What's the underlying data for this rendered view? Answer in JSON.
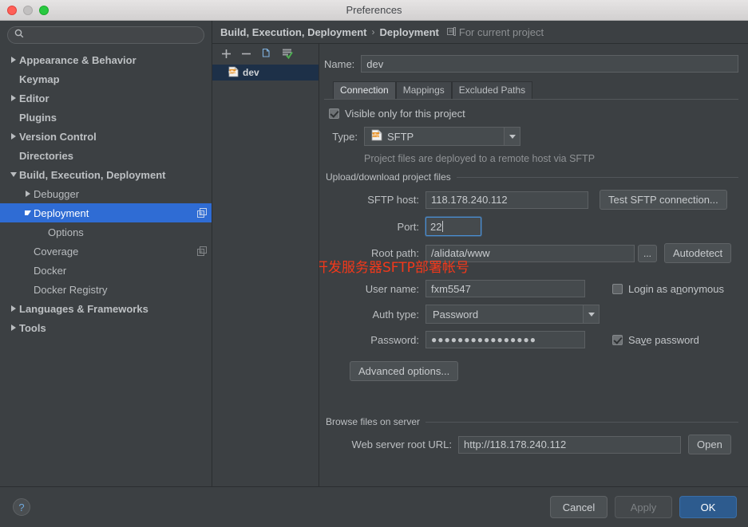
{
  "window": {
    "title": "Preferences"
  },
  "search": {
    "value": "",
    "placeholder": "",
    "icon": "search-icon"
  },
  "sidebar": {
    "items": [
      {
        "label": "Appearance & Behavior",
        "arrow": "right",
        "indent": 0,
        "bold": true,
        "selected": false,
        "badge": false
      },
      {
        "label": "Keymap",
        "arrow": "none",
        "indent": 0,
        "bold": true,
        "selected": false,
        "badge": false
      },
      {
        "label": "Editor",
        "arrow": "right",
        "indent": 0,
        "bold": true,
        "selected": false,
        "badge": false
      },
      {
        "label": "Plugins",
        "arrow": "none",
        "indent": 0,
        "bold": true,
        "selected": false,
        "badge": false
      },
      {
        "label": "Version Control",
        "arrow": "right",
        "indent": 0,
        "bold": true,
        "selected": false,
        "badge": false
      },
      {
        "label": "Directories",
        "arrow": "none",
        "indent": 0,
        "bold": true,
        "selected": false,
        "badge": false
      },
      {
        "label": "Build, Execution, Deployment",
        "arrow": "down",
        "indent": 0,
        "bold": true,
        "selected": false,
        "badge": false
      },
      {
        "label": "Debugger",
        "arrow": "right",
        "indent": 1,
        "bold": false,
        "selected": false,
        "badge": false
      },
      {
        "label": "Deployment",
        "arrow": "down",
        "indent": 1,
        "bold": false,
        "selected": true,
        "badge": true
      },
      {
        "label": "Options",
        "arrow": "none",
        "indent": 2,
        "bold": false,
        "selected": false,
        "badge": false
      },
      {
        "label": "Coverage",
        "arrow": "none",
        "indent": 1,
        "bold": false,
        "selected": false,
        "badge": true
      },
      {
        "label": "Docker",
        "arrow": "none",
        "indent": 1,
        "bold": false,
        "selected": false,
        "badge": false
      },
      {
        "label": "Docker Registry",
        "arrow": "none",
        "indent": 1,
        "bold": false,
        "selected": false,
        "badge": false
      },
      {
        "label": "Languages & Frameworks",
        "arrow": "right",
        "indent": 0,
        "bold": true,
        "selected": false,
        "badge": false
      },
      {
        "label": "Tools",
        "arrow": "right",
        "indent": 0,
        "bold": true,
        "selected": false,
        "badge": false
      }
    ]
  },
  "breadcrumb": {
    "root": "Build, Execution, Deployment",
    "separator": "›",
    "leaf": "Deployment",
    "scope_note": "For current project",
    "scope_icon": "project-scope-icon"
  },
  "server_list": {
    "toolbar": [
      {
        "name": "add-server-button",
        "glyph": "+"
      },
      {
        "name": "remove-server-button",
        "glyph": "−"
      },
      {
        "name": "copy-server-button",
        "glyph": "copy-icon"
      },
      {
        "name": "set-default-server-button",
        "glyph": "server-check-icon"
      }
    ],
    "items": [
      {
        "label": "dev",
        "icon": "sftp-icon",
        "selected": true
      }
    ]
  },
  "form": {
    "name_label": "Name:",
    "name_value": "dev",
    "tabs": [
      {
        "label": "Connection",
        "active": true
      },
      {
        "label": "Mappings",
        "active": false
      },
      {
        "label": "Excluded Paths",
        "active": false
      }
    ],
    "visible_only": {
      "label": "Visible only for this project",
      "checked": true
    },
    "type": {
      "label": "Type:",
      "value": "SFTP",
      "icon": "sftp-icon"
    },
    "type_hint": "Project files are deployed to a remote host via SFTP",
    "upload_group": "Upload/download project files",
    "sftp_host": {
      "label": "SFTP host:",
      "value": "118.178.240.112"
    },
    "test_button": "Test SFTP connection...",
    "port": {
      "label": "Port:",
      "value": "22",
      "focused": true
    },
    "root_path": {
      "label": "Root path:",
      "value": "/alidata/www"
    },
    "browse_button": "...",
    "autodetect_button": "Autodetect",
    "user_name": {
      "label": "User name:",
      "value": "fxm5547"
    },
    "login_anonymous": {
      "label_pre": "Login as a",
      "label_mnemonic": "n",
      "label_post": "onymous",
      "checked": false
    },
    "auth_type": {
      "label": "Auth type:",
      "value": "Password"
    },
    "password": {
      "label": "Password:",
      "value": "●●●●●●●●●●●●●●●●"
    },
    "save_password": {
      "label_pre": "Sa",
      "label_mnemonic": "v",
      "label_post": "e password",
      "checked": true
    },
    "advanced_button": "Advanced options...",
    "browse_group": "Browse files on server",
    "web_url": {
      "label": "Web server root URL:",
      "value": "http://118.178.240.112"
    },
    "open_button": "Open"
  },
  "annotation": {
    "text": "配置开发服务器SFTP部署帐号",
    "color": "#f4381a"
  },
  "footer": {
    "help": "?",
    "cancel": "Cancel",
    "apply": "Apply",
    "ok": "OK"
  },
  "colors": {
    "accent_selection": "#2f6cd4",
    "primary_button": "#2d5b8e",
    "annotation": "#f4381a",
    "panel_bg": "#3c4043"
  }
}
